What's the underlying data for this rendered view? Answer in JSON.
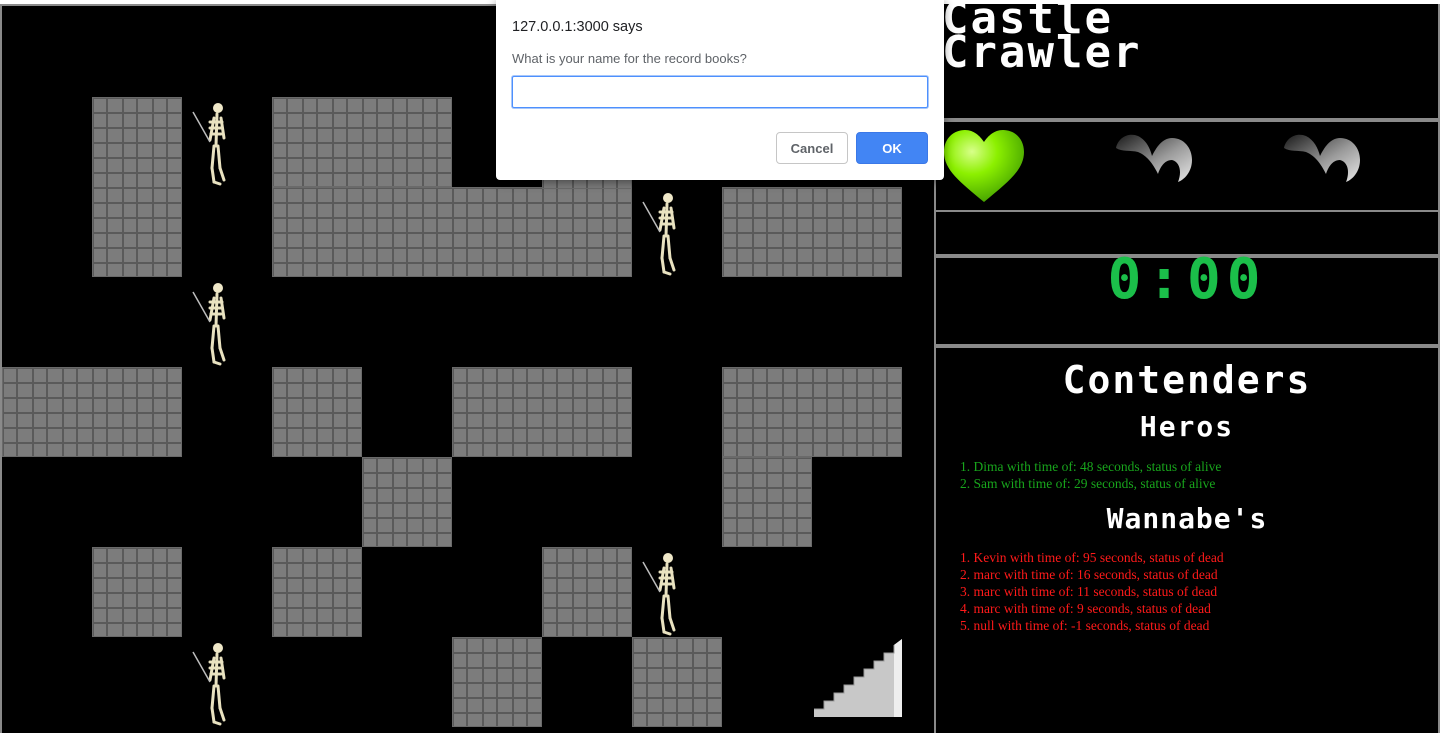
{
  "game": {
    "title": "Castle\nCrawler",
    "timer": "0:00",
    "lives": [
      {
        "state": "full",
        "color": "#8cf000"
      },
      {
        "state": "empty",
        "color": "#bdbdbd"
      },
      {
        "state": "empty",
        "color": "#bdbdbd"
      }
    ]
  },
  "scoreboard": {
    "title": "Contenders",
    "heros": {
      "title": "Heros",
      "color": "#18a51c",
      "entries": [
        "1. Dima with time of: 48 seconds, status of alive",
        "2. Sam with time of: 29 seconds, status of alive"
      ]
    },
    "wannabes": {
      "title": "Wannabe's",
      "color": "#ff1a1a",
      "entries": [
        "1. Kevin with time of: 95 seconds, status of dead",
        "2. marc with time of: 16 seconds, status of dead",
        "3. marc with time of: 11 seconds, status of dead",
        "4. marc with time of: 9 seconds, status of dead",
        "5. null with time of: -1 seconds, status of dead"
      ]
    }
  },
  "dialog": {
    "origin": "127.0.0.1:3000 says",
    "message": "What is your name for the record books?",
    "input_value": "",
    "cancel_label": "Cancel",
    "ok_label": "OK",
    "accent_color": "#4285f4"
  },
  "icons": {
    "enemy": "skeleton-icon",
    "exit": "stairs-icon",
    "life": "heart-icon"
  }
}
